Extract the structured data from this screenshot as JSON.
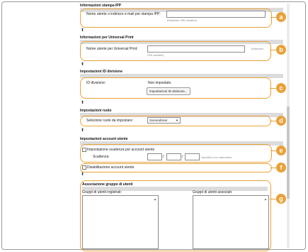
{
  "ipp": {
    "title": "Informazioni stampa IPP",
    "label": "Nome utente o indirizzo e-mail per stampa IPP:",
    "value": "",
    "hint": "(Massimo 256 caratteri)"
  },
  "universal": {
    "title": "Informazioni per Universal Print",
    "label": "Nome utente per Universal Print:",
    "value": "",
    "hint_line1": "(Massimo",
    "hint_line2": "256 caratteri)"
  },
  "division": {
    "title": "Impostazioni ID divisione",
    "label": "ID divisione:",
    "status": "Non impostato.",
    "button": "Impostazioni ID divisione..."
  },
  "role": {
    "title": "Impostazioni ruolo",
    "label": "Selezione ruolo da impostare:",
    "selected": "GeneralUser"
  },
  "account": {
    "title": "Impostazioni account utente",
    "expiry_checkbox": "Impostazione scadenza per account utente",
    "expiry_label": "Scadenza:",
    "slash": "/",
    "calendar_hint": "Specifica con calendario",
    "disable_checkbox": "Disabilitazione account utente"
  },
  "groups": {
    "title": "Associazione gruppo di utenti",
    "registered_label": "Gruppi di utenti registrati:",
    "associated_label": "Gruppi di utenti associati:"
  },
  "nav": {
    "up_arrow": "⬆"
  },
  "callouts": [
    "a",
    "b",
    "c",
    "d",
    "e",
    "f",
    "g"
  ],
  "colors": {
    "accent": "#e8a23a",
    "section_bar": "#dcdcdc"
  }
}
